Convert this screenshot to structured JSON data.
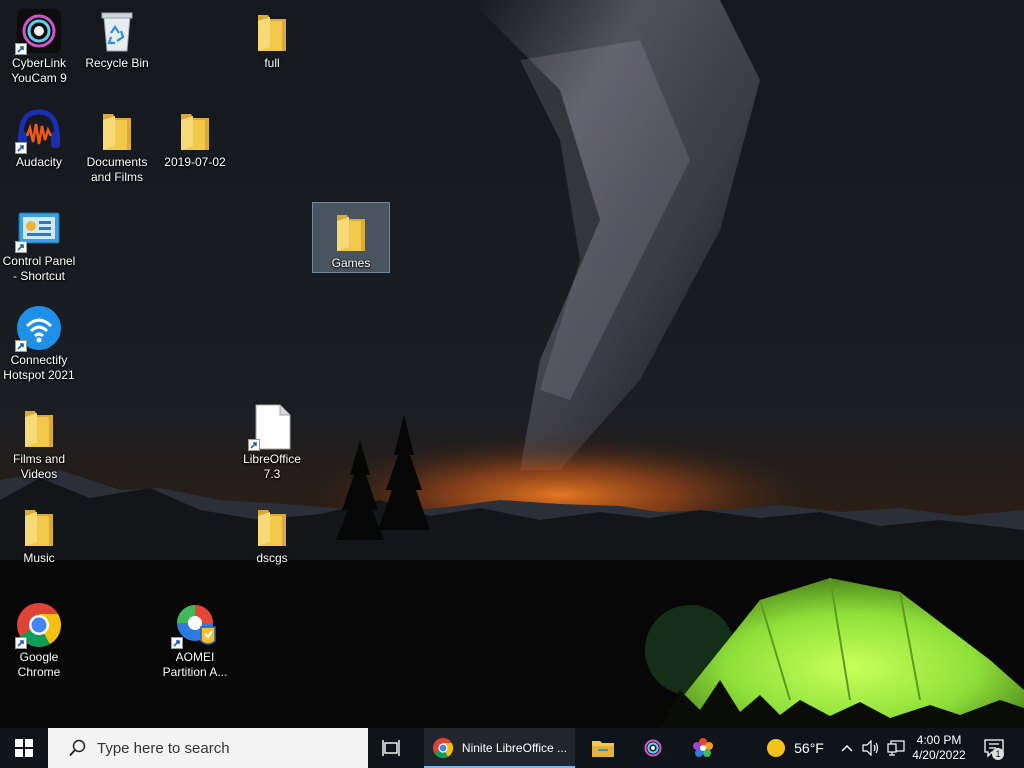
{
  "desktop": {
    "icons": [
      {
        "label": "CyberLink YouCam 9",
        "icon": "youcam-icon"
      },
      {
        "label": "Recycle Bin",
        "icon": "recycle-bin-icon"
      },
      {
        "label": "full",
        "icon": "folder-icon"
      },
      {
        "label": "Audacity",
        "icon": "audacity-icon"
      },
      {
        "label": "Documents and Films",
        "icon": "folder-icon"
      },
      {
        "label": "2019-07-02",
        "icon": "folder-icon"
      },
      {
        "label": "Control Panel - Shortcut",
        "icon": "control-panel-icon"
      },
      {
        "label": "Games",
        "icon": "folder-icon",
        "selected": true
      },
      {
        "label": "Connectify Hotspot 2021",
        "icon": "connectify-icon"
      },
      {
        "label": "Films and Videos",
        "icon": "folder-icon"
      },
      {
        "label": "LibreOffice 7.3",
        "icon": "libreoffice-icon"
      },
      {
        "label": "Music",
        "icon": "folder-icon"
      },
      {
        "label": "dscgs",
        "icon": "folder-icon"
      },
      {
        "label": "Google Chrome",
        "icon": "chrome-icon"
      },
      {
        "label": "AOMEI Partition A...",
        "icon": "aomei-icon"
      }
    ]
  },
  "taskbar": {
    "search_placeholder": "Type here to search",
    "active_window": "Ninite LibreOffice ...",
    "weather": {
      "temp": "56°F",
      "icon": "sun-icon"
    },
    "clock": {
      "time": "4:00 PM",
      "date": "4/20/2022"
    },
    "notification_count": "1"
  },
  "colors": {
    "taskbar": "#0f141b",
    "folder": "#f2c84b",
    "tent": "#8fe03a",
    "horizon_glow": "#e06a1c",
    "accent": "#76b9ed"
  }
}
